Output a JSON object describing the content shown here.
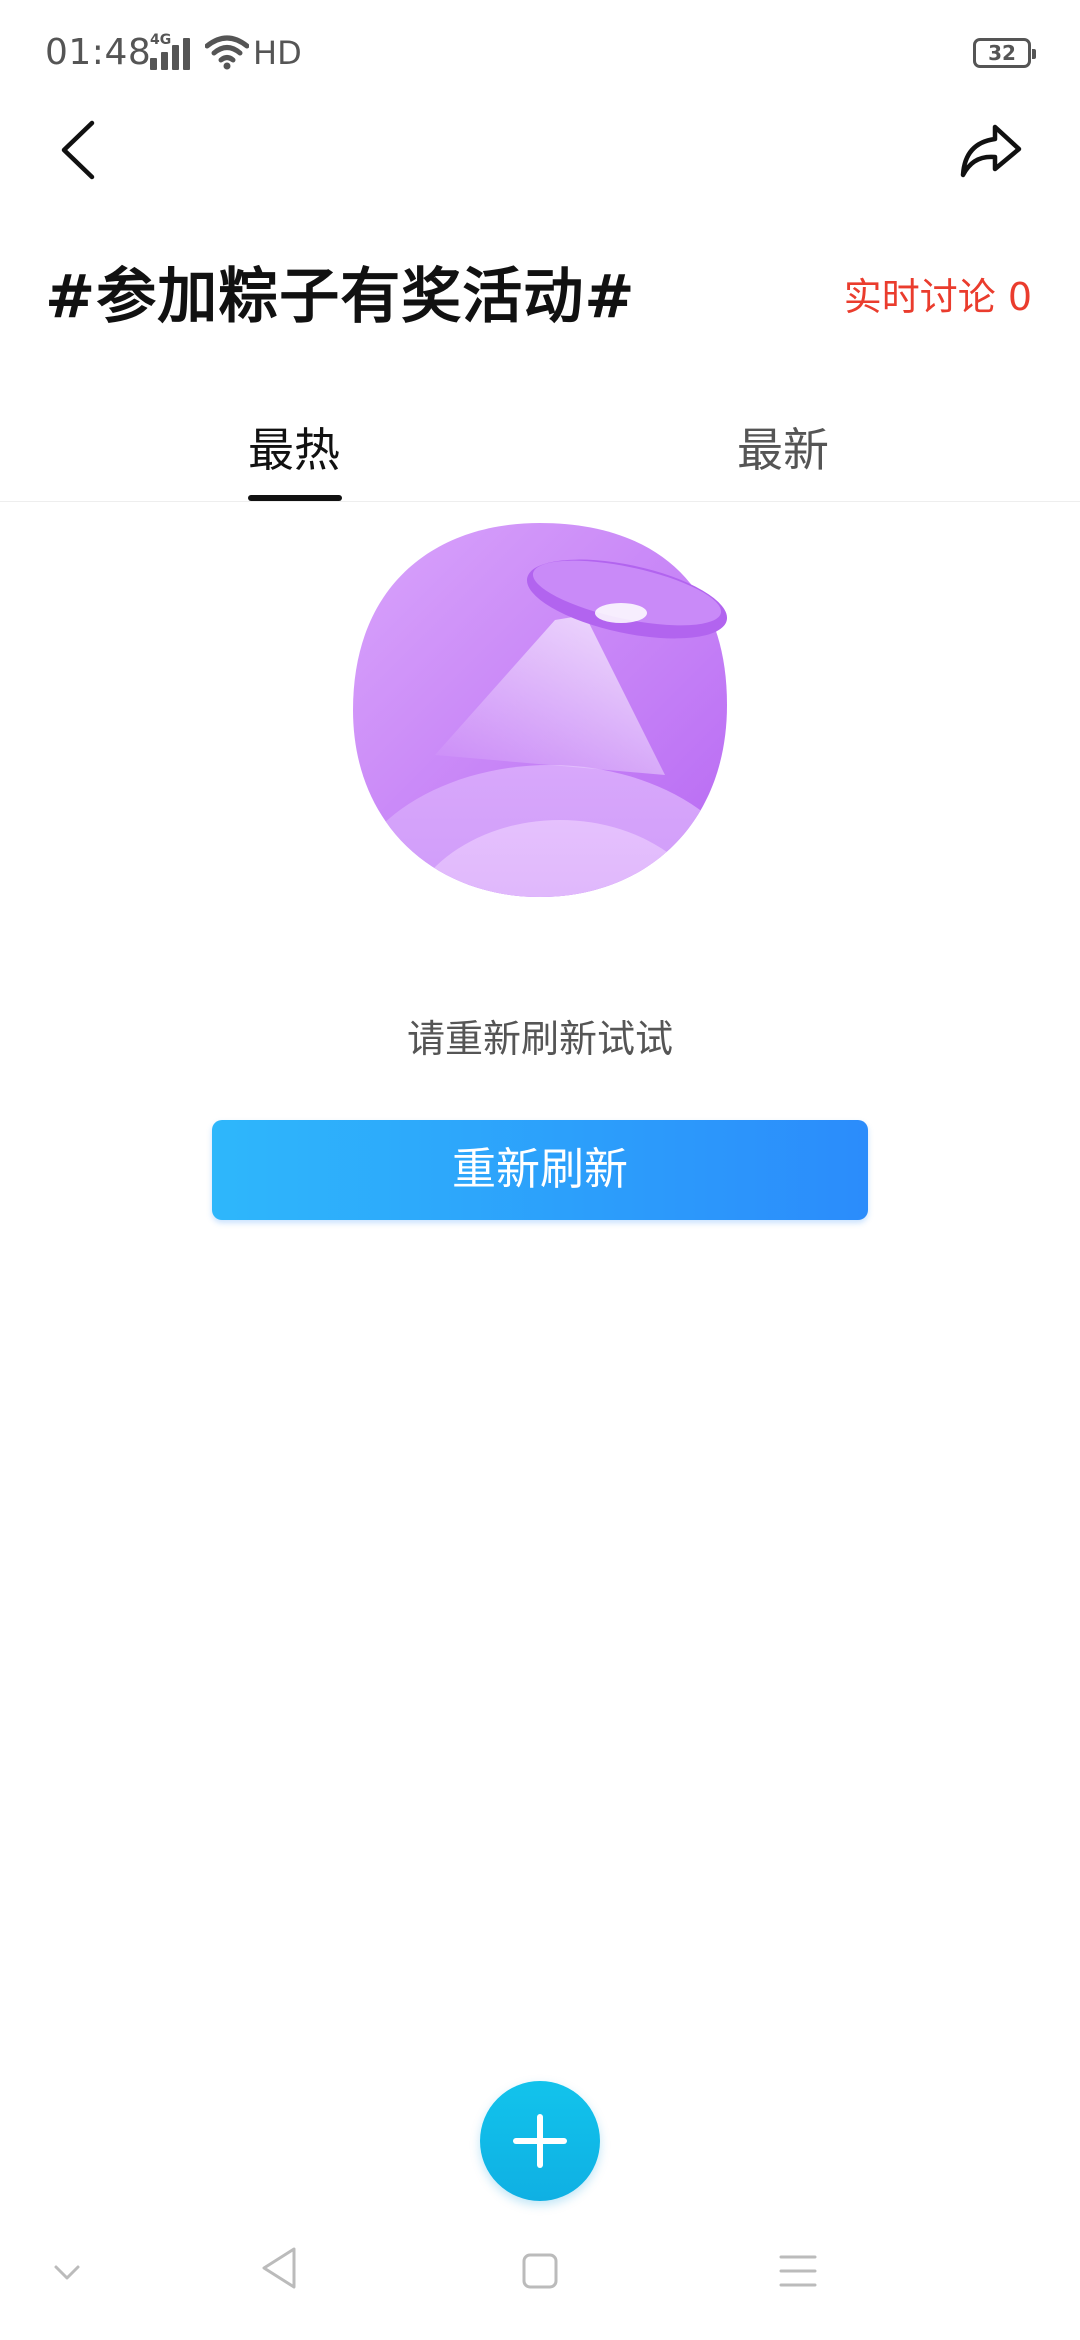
{
  "status_bar": {
    "time": "01:48",
    "network_type": "4G",
    "hd_label": "HD",
    "battery_level": "32"
  },
  "header": {
    "topic_title": "#参加粽子有奖活动#",
    "live_discussion": "实时讨论 0"
  },
  "tabs": [
    {
      "label": "最热",
      "active": true
    },
    {
      "label": "最新",
      "active": false
    }
  ],
  "empty_state": {
    "message": "请重新刷新试试",
    "refresh_button": "重新刷新"
  },
  "colors": {
    "accent_red": "#ea3c2d",
    "button_gradient_start": "#2eb7fb",
    "button_gradient_end": "#2b8cfb",
    "fab": "#12c3ec",
    "illustration_purple": "#c07bf6"
  },
  "icons": {
    "back": "chevron-left-icon",
    "share": "share-arrow-icon",
    "fab": "plus-icon"
  }
}
